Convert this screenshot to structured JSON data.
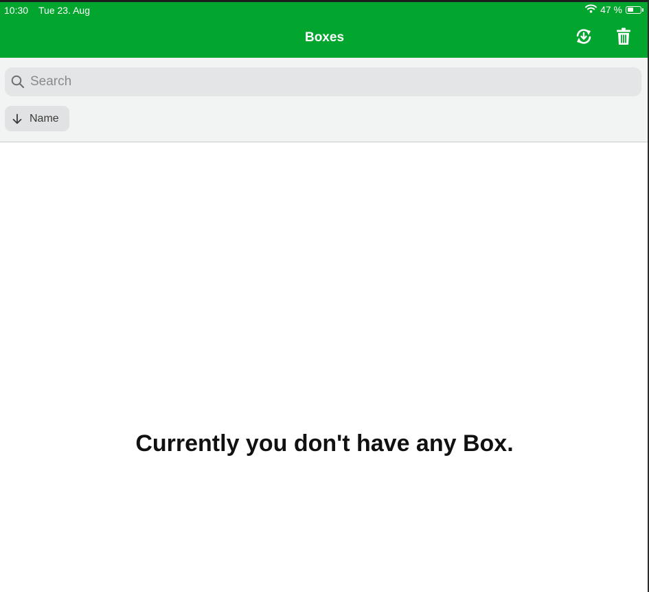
{
  "status_bar": {
    "time": "10:30",
    "date": "Tue 23. Aug",
    "battery_text": "47 %",
    "battery_level": 0.47,
    "wifi_icon": "wifi-icon"
  },
  "header": {
    "title": "Boxes",
    "background_color": "#02a62f",
    "actions": [
      {
        "name": "refresh-download",
        "icon": "refresh-download-icon"
      },
      {
        "name": "delete",
        "icon": "trash-icon"
      }
    ]
  },
  "search": {
    "placeholder": "Search",
    "value": "",
    "icon": "search-icon"
  },
  "sort": {
    "label": "Name",
    "direction_icon": "arrow-down-icon"
  },
  "empty_state": {
    "message": "Currently you don't have any Box."
  }
}
